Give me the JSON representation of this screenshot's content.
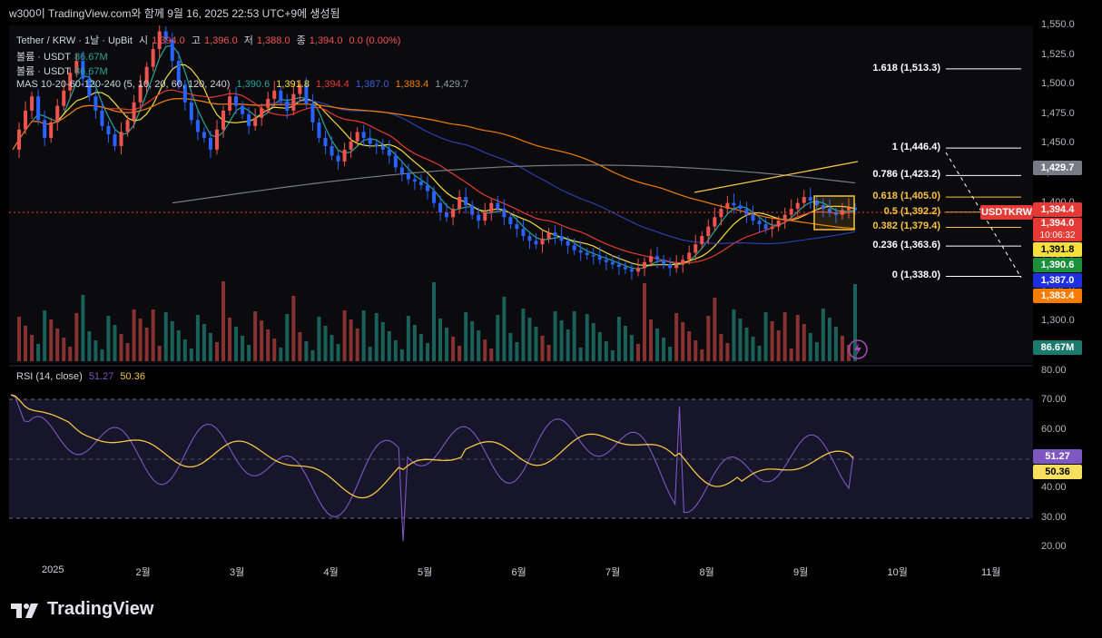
{
  "header": {
    "title": "w300이 TradingView.com와 함께 9월 16, 2025 22:53 UTC+9에 생성됨"
  },
  "legend": {
    "symbol": "Tether / KRW · 1날 · UpBit",
    "o_label": "시",
    "o_value": "1,394.0",
    "h_label": "고",
    "h_value": "1,396.0",
    "l_label": "저",
    "l_value": "1,388.0",
    "c_label": "종",
    "c_value": "1,394.0",
    "change": "0.0 (0.00%)",
    "vol1_label": "볼륨 · USDT",
    "vol1_value": "86.67M",
    "vol2_label": "볼륨 · USDT",
    "vol2_value": "86.67M",
    "ma_label": "MAS 10-20-60-120-240 (5, 10, 20, 60, 120, 240)",
    "ma_values": [
      "1,390.6",
      "1,391.8",
      "1,394.4",
      "1,387.0",
      "1,383.4",
      "1,429.7"
    ],
    "rsi_label": "RSI (14, close)",
    "rsi_value": "51.27",
    "rsi_ma_value": "50.36"
  },
  "colors": {
    "up": "#26a69a",
    "down": "#ef5350",
    "candle_up": "#ef5350",
    "candle_down": "#2962ff",
    "ma5": "#26a69a",
    "ma10": "#f7e03b",
    "ma20": "#e53935",
    "ma60": "#2a3fb0",
    "ma120": "#f57c00",
    "ma240": "#787b86",
    "rsi": "#7e57c2",
    "rsi_ma": "#f6c342",
    "fib": "#ffffff",
    "box": "#f6c342",
    "trend": "#f6c342"
  },
  "chart_data": {
    "type": "line",
    "title": "Tether / KRW · 1날 · UpBit",
    "price_axis": {
      "ticks": [
        "1,550.0",
        "1,525.0",
        "1,500.0",
        "1,475.0",
        "1,450.0",
        "1,425.0",
        "1,400.0",
        "1,375.0",
        "1,350.0",
        "1,325.0",
        "1,300.0"
      ],
      "ylim": [
        1290,
        1555
      ]
    },
    "rsi_axis": {
      "ticks": [
        "80.00",
        "70.00",
        "60.00",
        "50.00",
        "40.00",
        "30.00",
        "20.00"
      ],
      "ylim": [
        18,
        82
      ],
      "bands": [
        30,
        70
      ]
    },
    "x_axis": [
      "2025",
      "2월",
      "3월",
      "4월",
      "5월",
      "6월",
      "7월",
      "8월",
      "9월",
      "10월",
      "11월"
    ],
    "close_series": [
      1445,
      1462,
      1478,
      1490,
      1470,
      1455,
      1468,
      1482,
      1495,
      1510,
      1520,
      1505,
      1490,
      1478,
      1465,
      1458,
      1448,
      1460,
      1470,
      1485,
      1500,
      1515,
      1530,
      1545,
      1538,
      1520,
      1500,
      1485,
      1470,
      1460,
      1455,
      1445,
      1462,
      1478,
      1490,
      1482,
      1475,
      1465,
      1472,
      1480,
      1488,
      1495,
      1486,
      1478,
      1492,
      1500,
      1484,
      1468,
      1455,
      1448,
      1440,
      1435,
      1445,
      1452,
      1460,
      1455,
      1450,
      1448,
      1445,
      1440,
      1430,
      1425,
      1420,
      1418,
      1415,
      1410,
      1400,
      1392,
      1388,
      1395,
      1405,
      1398,
      1390,
      1385,
      1392,
      1400,
      1395,
      1388,
      1382,
      1378,
      1372,
      1368,
      1365,
      1370,
      1375,
      1372,
      1368,
      1364,
      1360,
      1358,
      1356,
      1355,
      1352,
      1350,
      1348,
      1346,
      1344,
      1342,
      1345,
      1350,
      1355,
      1352,
      1348,
      1345,
      1348,
      1352,
      1358,
      1365,
      1372,
      1380,
      1388,
      1395,
      1400,
      1398,
      1395,
      1390,
      1385,
      1382,
      1378,
      1380,
      1385,
      1390,
      1395,
      1400,
      1405,
      1402,
      1398,
      1395,
      1392,
      1390,
      1394,
      1396,
      1394
    ],
    "fib_levels": [
      {
        "label": "1.618 (1,513.3)",
        "value": 1513.3,
        "color": "#ffffff"
      },
      {
        "label": "1 (1,446.4)",
        "value": 1446.4,
        "color": "#ffffff"
      },
      {
        "label": "0.786 (1,423.2)",
        "value": 1423.2,
        "color": "#ffffff"
      },
      {
        "label": "0.618 (1,405.0)",
        "value": 1405.0,
        "color": "#f6c342"
      },
      {
        "label": "0.5 (1,392.2)",
        "value": 1392.2,
        "color": "#f6c342"
      },
      {
        "label": "0.382 (1,379.4)",
        "value": 1379.4,
        "color": "#f6c342"
      },
      {
        "label": "0.236 (1,363.6)",
        "value": 1363.6,
        "color": "#ffffff"
      },
      {
        "label": "0 (1,338.0)",
        "value": 1338.0,
        "color": "#ffffff"
      }
    ],
    "price_tags": [
      {
        "text": "1,429.7",
        "bg": "#787b86",
        "fg": "#ffffff",
        "value": 1429.7
      },
      {
        "text": "1,394.4",
        "bg": "#e53935",
        "fg": "#ffffff",
        "value": 1394.4
      },
      {
        "text": "1,394.0",
        "bg": "#e53935",
        "fg": "#ffffff",
        "value": 1394.0,
        "sub": "10:06:32"
      },
      {
        "text": "1,391.8",
        "bg": "#f7e03b",
        "fg": "#000000",
        "value": 1391.8
      },
      {
        "text": "1,390.6",
        "bg": "#1b8f3a",
        "fg": "#ffffff",
        "value": 1390.6
      },
      {
        "text": "1,387.0",
        "bg": "#1e2fe0",
        "fg": "#ffffff",
        "value": 1387.0
      },
      {
        "text": "1,383.4",
        "bg": "#f57c00",
        "fg": "#ffffff",
        "value": 1383.4
      }
    ],
    "symbol_tag": "USDTKRW",
    "volume_tag": "86.67M",
    "rsi_tags": [
      {
        "text": "51.27",
        "bg": "#7e57c2",
        "fg": "#ffffff"
      },
      {
        "text": "50.36",
        "bg": "#f6e05e",
        "fg": "#000000"
      }
    ]
  },
  "footer": {
    "brand": "TradingView"
  }
}
